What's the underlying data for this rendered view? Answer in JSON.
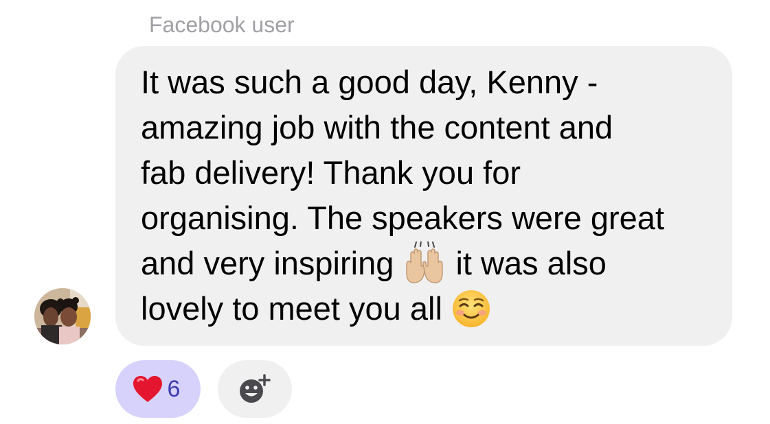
{
  "message": {
    "sender_name": "Facebook user",
    "lines": [
      {
        "text": "It was such a good day, Kenny -"
      },
      {
        "text": "amazing job with the content and"
      },
      {
        "text": "fab delivery! Thank you for"
      },
      {
        "text": "organising. The speakers were great"
      },
      {
        "before": "and very inspiring ",
        "emoji": "raising-hands-icon",
        "after": " it was also"
      },
      {
        "before": "lovely to meet you all ",
        "emoji": "smiling-face-icon",
        "after": ""
      }
    ],
    "bubble_color": "#f0f0f0"
  },
  "reactions": {
    "heart": {
      "icon": "red-heart-icon",
      "count": "6",
      "pill_color": "#d7d2fb",
      "count_color": "#3c3cb0"
    },
    "add_reaction": {
      "icon": "add-reaction-icon"
    }
  }
}
